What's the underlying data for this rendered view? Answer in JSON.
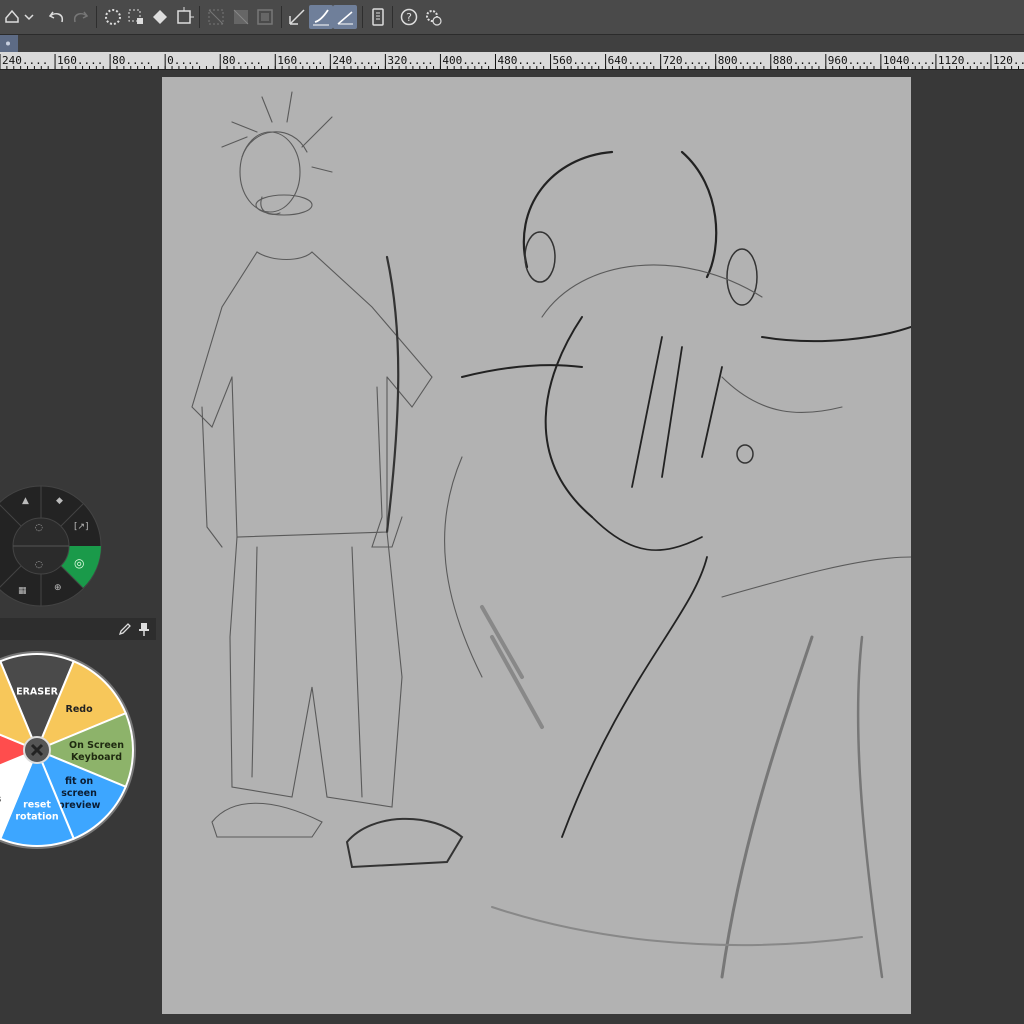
{
  "ruler": {
    "labels": [
      "240",
      "160",
      "80",
      "0",
      "80",
      "160",
      "240",
      "320",
      "400",
      "480",
      "560",
      "640",
      "720",
      "800",
      "880",
      "960",
      "1040",
      "1120",
      "120"
    ]
  },
  "radial_menu": {
    "items": [
      {
        "label": "ERASER",
        "color": "#4a4a4a",
        "text_color": "#ffffff"
      },
      {
        "label": "Redo",
        "color": "#f7c75a",
        "text_color": "#222222"
      },
      {
        "label_lines": [
          "On Screen",
          "Keyboard"
        ],
        "color": "#8db36a",
        "text_color": "#1f2a10"
      },
      {
        "label_lines": [
          "fit on",
          "screen",
          "preview"
        ],
        "color": "#3da6ff",
        "text_color": "#0b1d33"
      },
      {
        "label_lines": [
          "reset",
          "rotation"
        ],
        "color": "#3da6ff",
        "text_color": "#ffffff"
      },
      {
        "label_lines": [
          "e",
          "gs"
        ],
        "color": "#ffffff",
        "text_color": "#222222"
      },
      {
        "label": "",
        "color": "#ff4d4d",
        "text_color": "#ffffff"
      },
      {
        "label": "",
        "color": "#f7c75a",
        "text_color": "#222222"
      }
    ]
  },
  "colors": {
    "toolbar_bg": "#4a4a4a",
    "canvas_bg": "#b2b2b2",
    "workspace_bg": "#383838",
    "active_tool": "#6f7f9a"
  }
}
